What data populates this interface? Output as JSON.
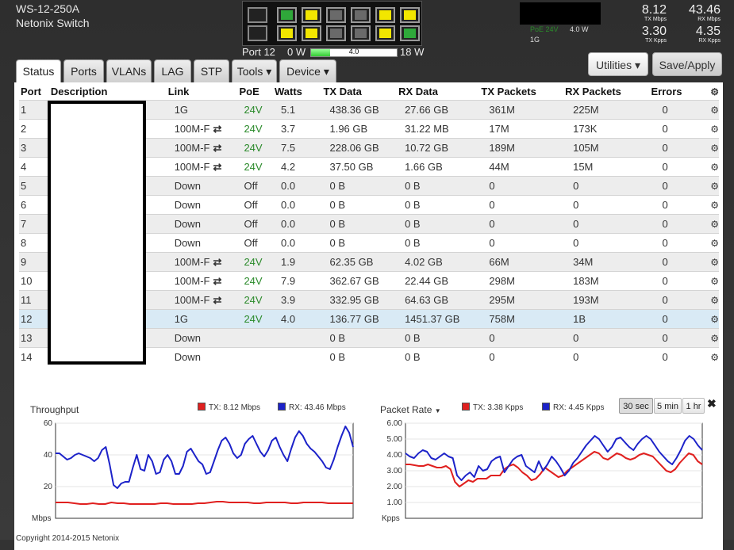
{
  "header": {
    "model": "WS-12-250A",
    "device_name": "Netonix Switch",
    "selected_port": "Port 12",
    "power_min": "0 W",
    "power_value": "4.0",
    "power_fraction": 0.22,
    "power_max": "18 W",
    "poe_label": "PoE 24V",
    "poe_watts": "4.0 W",
    "link_speed": "1G",
    "tx_mbps": "8.12",
    "tx_mbps_unit": "TX Mbps",
    "rx_mbps": "43.46",
    "rx_mbps_unit": "RX Mbps",
    "tx_kpps": "3.30",
    "tx_kpps_unit": "TX Kpps",
    "rx_kpps": "4.35",
    "rx_kpps_unit": "RX Kpps"
  },
  "port_panel": {
    "top": [
      "off",
      "green",
      "yellow",
      "gray",
      "gray",
      "yellow",
      "yellow"
    ],
    "bottom": [
      "off",
      "yellow",
      "yellow",
      "gray",
      "gray",
      "yellow",
      "green"
    ]
  },
  "colors": {
    "green": "#2fa83a",
    "yellow": "#f2e600",
    "gray": "#6a6a6a",
    "off": "#222222",
    "tx": "#e0201f",
    "rx": "#1c22c9"
  },
  "buttons": {
    "utilities": "Utilities ▾",
    "save_apply": "Save/Apply"
  },
  "tabs": [
    {
      "label": "Status"
    },
    {
      "label": "Ports"
    },
    {
      "label": "VLANs"
    },
    {
      "label": "LAG"
    },
    {
      "label": "STP"
    },
    {
      "label": "Tools ▾"
    },
    {
      "label": "Device ▾"
    }
  ],
  "table": {
    "headers": [
      "Port",
      "Description",
      "Link",
      "PoE",
      "Watts",
      "TX Data",
      "RX Data",
      "TX Packets",
      "RX Packets",
      "Errors"
    ],
    "rows": [
      {
        "port": "1",
        "link": "1G",
        "dup": "",
        "poe": "24V",
        "watts": "5.1",
        "tx": "438.36 GB",
        "rx": "27.66 GB",
        "txp": "361M",
        "rxp": "225M",
        "err": "0"
      },
      {
        "port": "2",
        "link": "100M-F",
        "dup": "⇄",
        "poe": "24V",
        "watts": "3.7",
        "tx": "1.96 GB",
        "rx": "31.22 MB",
        "txp": "17M",
        "rxp": "173K",
        "err": "0"
      },
      {
        "port": "3",
        "link": "100M-F",
        "dup": "⇄",
        "poe": "24V",
        "watts": "7.5",
        "tx": "228.06 GB",
        "rx": "10.72 GB",
        "txp": "189M",
        "rxp": "105M",
        "err": "0"
      },
      {
        "port": "4",
        "link": "100M-F",
        "dup": "⇄",
        "poe": "24V",
        "watts": "4.2",
        "tx": "37.50 GB",
        "rx": "1.66 GB",
        "txp": "44M",
        "rxp": "15M",
        "err": "0"
      },
      {
        "port": "5",
        "link": "Down",
        "dup": "",
        "poe": "Off",
        "watts": "0.0",
        "tx": "0 B",
        "rx": "0 B",
        "txp": "0",
        "rxp": "0",
        "err": "0"
      },
      {
        "port": "6",
        "link": "Down",
        "dup": "",
        "poe": "Off",
        "watts": "0.0",
        "tx": "0 B",
        "rx": "0 B",
        "txp": "0",
        "rxp": "0",
        "err": "0"
      },
      {
        "port": "7",
        "link": "Down",
        "dup": "",
        "poe": "Off",
        "watts": "0.0",
        "tx": "0 B",
        "rx": "0 B",
        "txp": "0",
        "rxp": "0",
        "err": "0"
      },
      {
        "port": "8",
        "link": "Down",
        "dup": "",
        "poe": "Off",
        "watts": "0.0",
        "tx": "0 B",
        "rx": "0 B",
        "txp": "0",
        "rxp": "0",
        "err": "0"
      },
      {
        "port": "9",
        "link": "100M-F",
        "dup": "⇄",
        "poe": "24V",
        "watts": "1.9",
        "tx": "62.35 GB",
        "rx": "4.02 GB",
        "txp": "66M",
        "rxp": "34M",
        "err": "0"
      },
      {
        "port": "10",
        "link": "100M-F",
        "dup": "⇄",
        "poe": "24V",
        "watts": "7.9",
        "tx": "362.67 GB",
        "rx": "22.44 GB",
        "txp": "298M",
        "rxp": "183M",
        "err": "0"
      },
      {
        "port": "11",
        "link": "100M-F",
        "dup": "⇄",
        "poe": "24V",
        "watts": "3.9",
        "tx": "332.95 GB",
        "rx": "64.63 GB",
        "txp": "295M",
        "rxp": "193M",
        "err": "0"
      },
      {
        "port": "12",
        "link": "1G",
        "dup": "",
        "poe": "24V",
        "watts": "4.0",
        "tx": "136.77 GB",
        "rx": "1451.37 GB",
        "txp": "758M",
        "rxp": "1B",
        "err": "0"
      },
      {
        "port": "13",
        "link": "Down",
        "dup": "",
        "poe": "",
        "watts": "",
        "tx": "0 B",
        "rx": "0 B",
        "txp": "0",
        "rxp": "0",
        "err": "0"
      },
      {
        "port": "14",
        "link": "Down",
        "dup": "",
        "poe": "",
        "watts": "",
        "tx": "0 B",
        "rx": "0 B",
        "txp": "0",
        "rxp": "0",
        "err": "0"
      }
    ]
  },
  "chart_data": [
    {
      "type": "line",
      "title": "Throughput",
      "ylabel": "Mbps",
      "ylim": [
        0,
        60
      ],
      "yticks": [
        "60",
        "40",
        "20"
      ],
      "legend": [
        "TX: 8.12 Mbps",
        "RX: 43.46 Mbps"
      ],
      "series": [
        {
          "name": "TX",
          "values": [
            10,
            10,
            10,
            9.5,
            9,
            9,
            9.5,
            9,
            9,
            10,
            9.5,
            9.5,
            9,
            9,
            9,
            9,
            9,
            9.5,
            9.5,
            9,
            9,
            9,
            9,
            9.5,
            9.5,
            10,
            10.5,
            10.5,
            10,
            10,
            10,
            10,
            9.5,
            9.5,
            10,
            10,
            10,
            10,
            9.5,
            9.5,
            10,
            10,
            10,
            10,
            9.5,
            9.5,
            9.5,
            9.5,
            9.5
          ]
        },
        {
          "name": "RX",
          "values": [
            41,
            41,
            39,
            37,
            38,
            40,
            41,
            40,
            39,
            38,
            36,
            38,
            43,
            45,
            34,
            21,
            19,
            22,
            23,
            23,
            32,
            40,
            31,
            30,
            40,
            36,
            28,
            29,
            37,
            40,
            36,
            28,
            28,
            33,
            42,
            44,
            40,
            36,
            34,
            28,
            29,
            36,
            43,
            49,
            51,
            47,
            41,
            38,
            40,
            47,
            50,
            52,
            47,
            42,
            39,
            43,
            49,
            51,
            45,
            40,
            36,
            44,
            51,
            55,
            52,
            47,
            44,
            42,
            39,
            36,
            32,
            31,
            37,
            45,
            52,
            58,
            54,
            45
          ]
        }
      ]
    },
    {
      "type": "line",
      "title": "Packet Rate",
      "ylabel": "Kpps",
      "ylim": [
        0,
        6
      ],
      "yticks": [
        "6.00",
        "5.00",
        "4.00",
        "3.00",
        "2.00",
        "1.00"
      ],
      "legend": [
        "TX: 3.38 Kpps",
        "RX: 4.45 Kpps"
      ],
      "series": [
        {
          "name": "TX",
          "values": [
            3.4,
            3.4,
            3.35,
            3.3,
            3.3,
            3.4,
            3.3,
            3.2,
            3.2,
            3.3,
            3.1,
            2.3,
            2.0,
            2.2,
            2.4,
            2.3,
            2.5,
            2.5,
            2.5,
            2.7,
            2.7,
            2.7,
            3.1,
            3.3,
            3.4,
            3.2,
            2.9,
            2.7,
            2.4,
            2.5,
            2.8,
            3.2,
            3.0,
            2.8,
            2.6,
            2.7,
            3.0,
            3.2,
            3.4,
            3.6,
            3.8,
            4.0,
            4.2,
            4.1,
            3.8,
            3.7,
            3.9,
            4.1,
            4.0,
            3.8,
            3.7,
            3.8,
            4.0,
            4.1,
            4.0,
            3.9,
            3.6,
            3.3,
            3.0,
            2.9,
            3.1,
            3.5,
            3.8,
            4.1,
            4.0,
            3.6,
            3.4
          ]
        },
        {
          "name": "RX",
          "values": [
            4.1,
            3.9,
            3.8,
            4.1,
            4.3,
            4.2,
            3.8,
            3.7,
            3.9,
            4.1,
            3.9,
            3.8,
            2.7,
            2.4,
            2.7,
            2.9,
            2.6,
            3.3,
            3.0,
            3.1,
            3.6,
            3.8,
            3.9,
            2.9,
            3.3,
            3.7,
            3.9,
            4.0,
            3.3,
            3.1,
            2.9,
            3.6,
            3.0,
            3.4,
            3.9,
            3.6,
            3.2,
            2.7,
            3.0,
            3.5,
            3.8,
            4.2,
            4.6,
            4.9,
            5.2,
            5.0,
            4.6,
            4.2,
            4.5,
            5.0,
            5.1,
            4.8,
            4.5,
            4.3,
            4.7,
            5.0,
            5.2,
            5.0,
            4.6,
            4.2,
            3.9,
            3.6,
            3.4,
            3.8,
            4.3,
            4.9,
            5.2,
            5.0,
            4.6,
            4.3
          ]
        }
      ]
    }
  ],
  "chart_controls": {
    "ranges": [
      "30 sec",
      "5 min",
      "1 hr"
    ],
    "close": "✖"
  },
  "footer": {
    "copyright": "Copyright 2014-2015 Netonix"
  }
}
